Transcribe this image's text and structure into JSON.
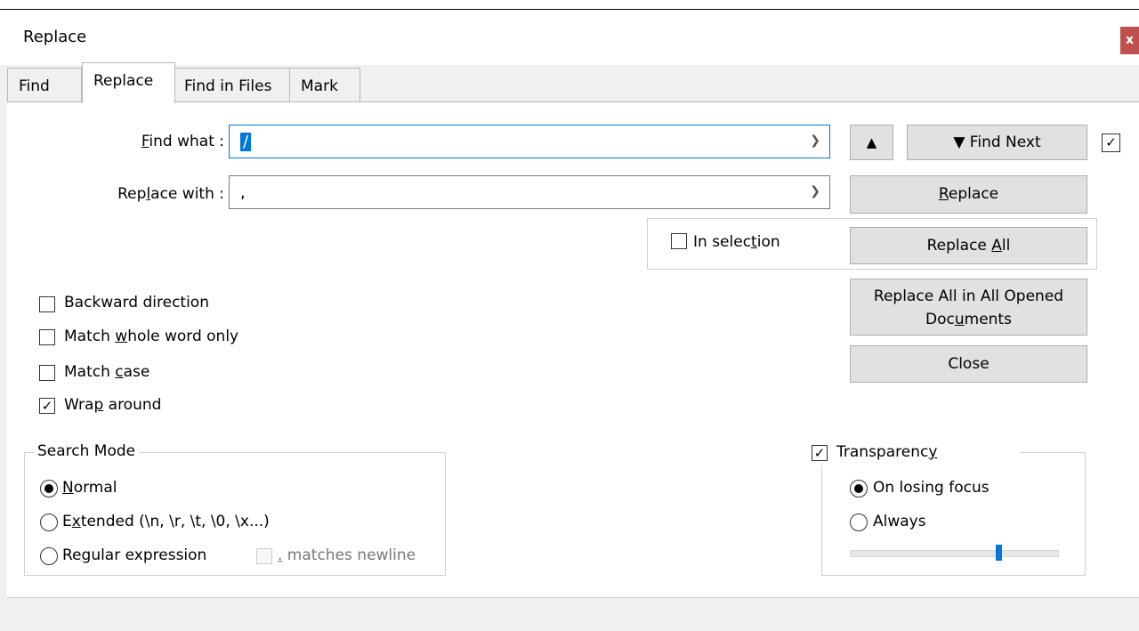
{
  "window": {
    "title": "Replace",
    "close_label": "x"
  },
  "tabs": [
    {
      "label": "Find",
      "active": false
    },
    {
      "label": "Replace",
      "active": true
    },
    {
      "label": "Find in Files",
      "active": false
    },
    {
      "label": "Mark",
      "active": false
    }
  ],
  "find_what": {
    "label_pre": "",
    "label_u": "F",
    "label_post": "ind what :",
    "value": "/"
  },
  "replace_with": {
    "label_pre": "Rep",
    "label_u": "l",
    "label_post": "ace with :",
    "value": ","
  },
  "buttons": {
    "prev_label": "▲",
    "find_next_label": "▼ Find Next",
    "replace": {
      "pre": "",
      "u": "R",
      "post": "eplace"
    },
    "replace_all": {
      "pre": "Replace ",
      "u": "A",
      "post": "ll"
    },
    "replace_all_docs_line1": "Replace All in All Opened",
    "replace_all_docs": {
      "pre": "Doc",
      "u": "u",
      "post": "ments"
    },
    "close_label": "Close"
  },
  "find_next_checkbox": {
    "checked": true,
    "mark": "✓"
  },
  "in_selection": {
    "pre": "In selec",
    "u": "t",
    "post": "ion",
    "checked": false
  },
  "options": [
    {
      "pre": "Backward direction",
      "u": "",
      "post": "",
      "checked": false
    },
    {
      "pre": "Match ",
      "u": "w",
      "post": "hole word only",
      "checked": false
    },
    {
      "pre": "Match ",
      "u": "c",
      "post": "ase",
      "checked": false
    },
    {
      "pre": "Wra",
      "u": "p",
      "post": " around",
      "checked": true
    }
  ],
  "search_mode": {
    "legend": "Search Mode",
    "modes": [
      {
        "pre": "",
        "u": "N",
        "post": "ormal",
        "selected": true
      },
      {
        "pre": "E",
        "u": "x",
        "post": "tended (\\n, \\r, \\t, \\0, \\x...)",
        "selected": false
      },
      {
        "pre": "Re",
        "u": "g",
        "post": "ular expression",
        "selected": false
      }
    ],
    "matches_newline": {
      "u": ".",
      "post": " matches newline",
      "checked": false
    }
  },
  "transparency": {
    "label": {
      "pre": "Transparenc",
      "u": "y",
      "post": ""
    },
    "checked": true,
    "options": [
      {
        "label": "On losing focus",
        "selected": true
      },
      {
        "label": "Always",
        "selected": false
      }
    ],
    "slider_level": 0.72
  },
  "colors": {
    "accent": "#0078d7",
    "close_button": "#c0504d"
  }
}
